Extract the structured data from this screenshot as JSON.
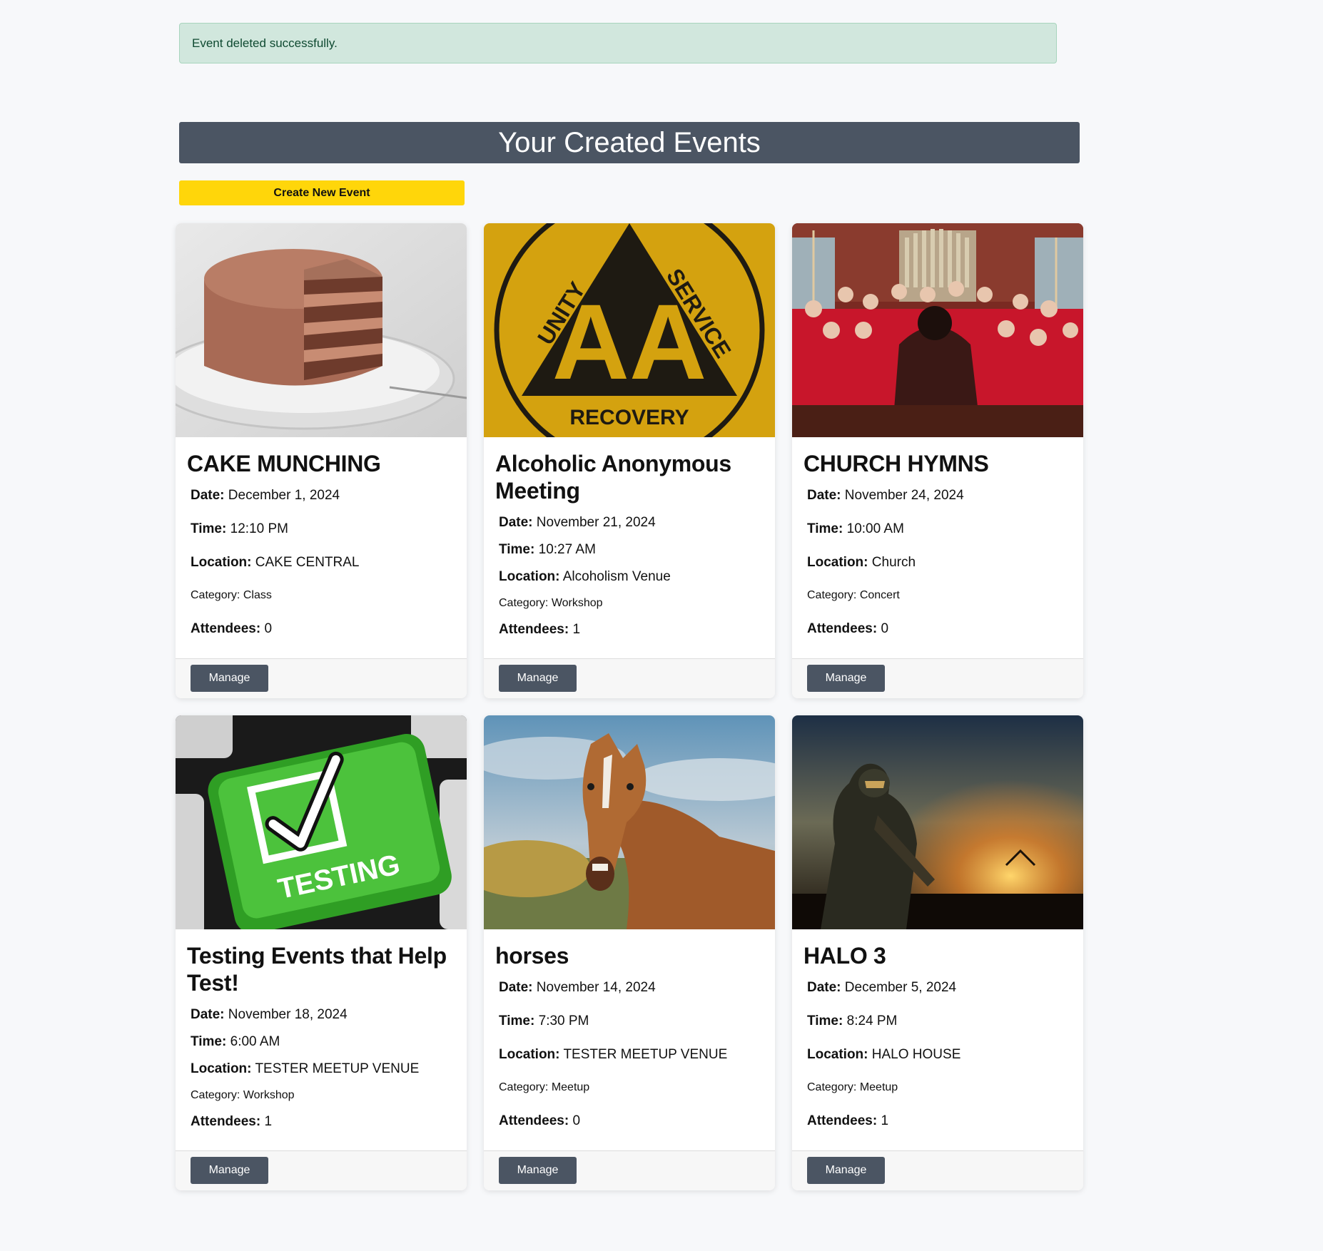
{
  "alert": {
    "message": "Event deleted successfully."
  },
  "header": {
    "title": "Your Created Events"
  },
  "toolbar": {
    "create_label": "Create New Event"
  },
  "labels": {
    "date": "Date:",
    "time": "Time:",
    "location": "Location:",
    "category": "Category:",
    "attendees": "Attendees:",
    "manage": "Manage"
  },
  "events": [
    {
      "title": "CAKE MUNCHING",
      "date": "December 1, 2024",
      "time": "12:10 PM",
      "location": "CAKE CENTRAL",
      "category": "Class",
      "attendees": "0",
      "image": "chocolate-cake-photo"
    },
    {
      "title": "Alcoholic Anonymous Meeting",
      "date": "November 21, 2024",
      "time": "10:27 AM",
      "location": "Alcoholism Venue",
      "category": "Workshop",
      "attendees": "1",
      "image": "aa-recovery-logo",
      "image_text": {
        "left": "UNITY",
        "right": "SERVICE",
        "center": "AA",
        "bottom": "RECOVERY"
      }
    },
    {
      "title": "CHURCH HYMNS",
      "date": "November 24, 2024",
      "time": "10:00 AM",
      "location": "Church",
      "category": "Concert",
      "attendees": "0",
      "image": "church-choir-photo"
    },
    {
      "title": "Testing Events that Help Test!",
      "date": "November 18, 2024",
      "time": "6:00 AM",
      "location": "TESTER MEETUP VENUE",
      "category": "Workshop",
      "attendees": "1",
      "image": "testing-keyboard-key",
      "image_text": {
        "key": "TESTING"
      }
    },
    {
      "title": "horses",
      "date": "November 14, 2024",
      "time": "7:30 PM",
      "location": "TESTER MEETUP VENUE",
      "category": "Meetup",
      "attendees": "0",
      "image": "horse-photo"
    },
    {
      "title": "HALO 3",
      "date": "December 5, 2024",
      "time": "8:24 PM",
      "location": "HALO HOUSE",
      "category": "Meetup",
      "attendees": "1",
      "image": "halo3-soldier-artwork"
    }
  ]
}
